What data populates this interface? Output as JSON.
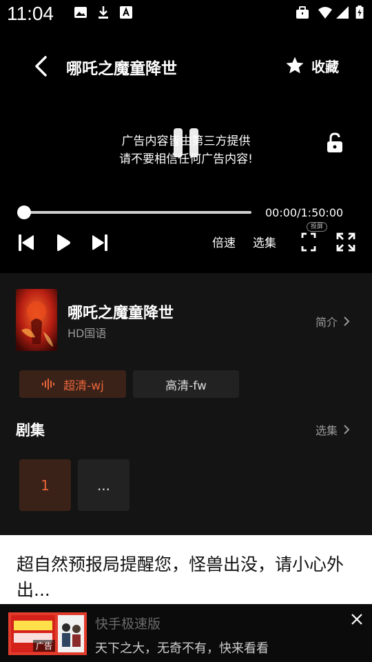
{
  "status_bar": {
    "time": "11:04",
    "left_icons": [
      "image-icon",
      "download-icon",
      "font-icon"
    ],
    "right_icons": [
      "briefcase-icon",
      "wifi-icon",
      "signal-icon",
      "battery-charging-icon"
    ]
  },
  "player": {
    "title": "哪吒之魔童降世",
    "favorite_label": "收藏",
    "ad_notice_line1": "广告内容皆由第三方提供",
    "ad_notice_line2": "请不要相信任何广告内容!",
    "time_readout": "00:00/1:50:00",
    "progress": 0,
    "speed_label": "倍速",
    "episodes_label": "选集",
    "cast_badge": "投屏"
  },
  "info": {
    "movie_name": "哪吒之魔童降世",
    "meta": "HD国语",
    "intro_label": "简介",
    "sources": [
      {
        "label": "超清-wj",
        "active": true
      },
      {
        "label": "高清-fw",
        "active": false
      }
    ],
    "episodes_heading": "剧集",
    "episodes_more_label": "选集",
    "episodes": [
      "1",
      "..."
    ]
  },
  "notice": {
    "text": "超自然预报局提醒您，怪兽出没，请小心外出..."
  },
  "ad": {
    "thumb_tag": "广告",
    "app_name": "快手极速版",
    "slogan": "天下之大，无奇不有，快来看看"
  },
  "colors": {
    "accent": "#e8653a",
    "accent_bg": "#3a2219",
    "panel_bg": "#141414"
  }
}
